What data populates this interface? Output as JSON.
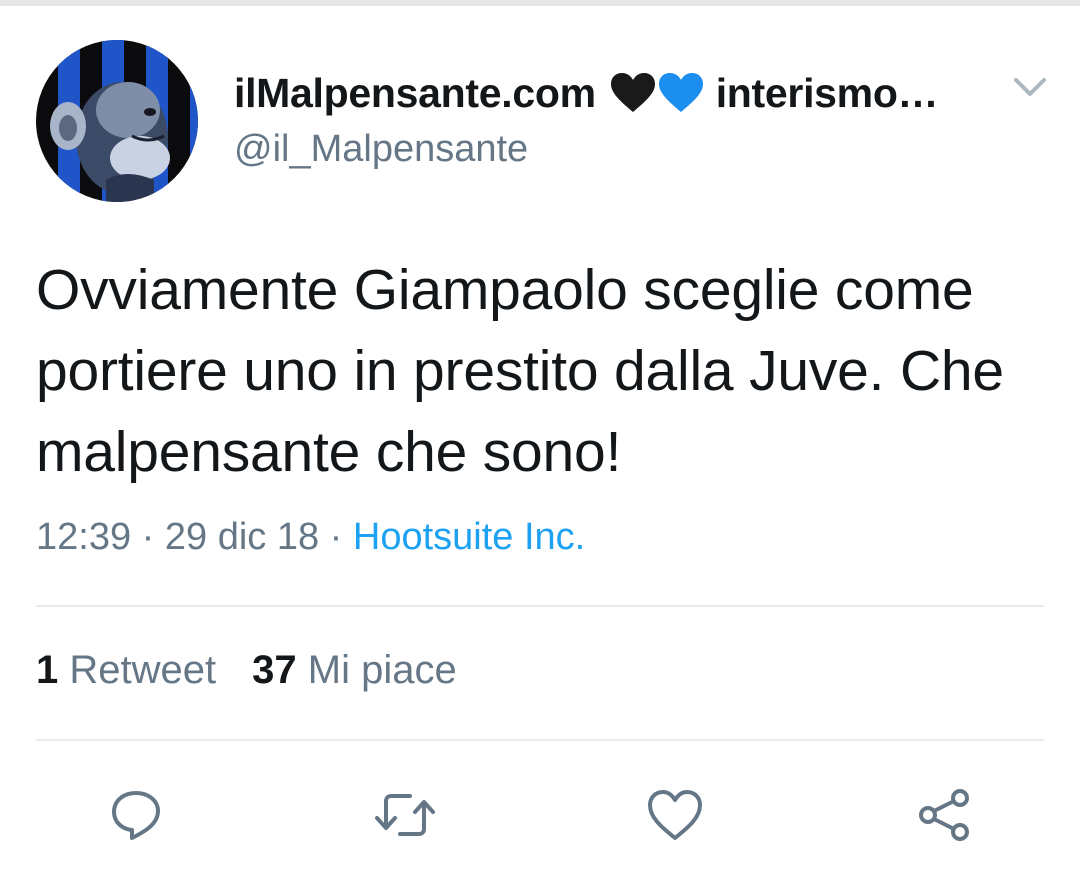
{
  "tweet": {
    "display_name": "ilMalpensante.com",
    "display_name_suffix": "interismo…",
    "handle": "@il_Malpensante",
    "text": "Ovviamente Giampaolo sceglie come portiere uno in prestito dalla Juve. Che malpensante che sono!",
    "time": "12:39",
    "separator": "·",
    "date": "29 dic 18",
    "source": "Hootsuite Inc.",
    "retweet_count": "1",
    "retweet_label": "Retweet",
    "like_count": "37",
    "like_label": "Mi piace"
  },
  "icons": {
    "hearts": [
      "black-heart-icon",
      "blue-heart-icon"
    ],
    "menu": "chevron-down-icon",
    "actions": [
      "reply-icon",
      "retweet-icon",
      "like-icon",
      "share-icon"
    ]
  },
  "colors": {
    "text_primary": "#14171a",
    "text_secondary": "#657786",
    "link": "#1da1f2",
    "divider": "#e6ecf0",
    "heart_black": "#1a1a1a",
    "heart_blue": "#1c8ef0"
  }
}
